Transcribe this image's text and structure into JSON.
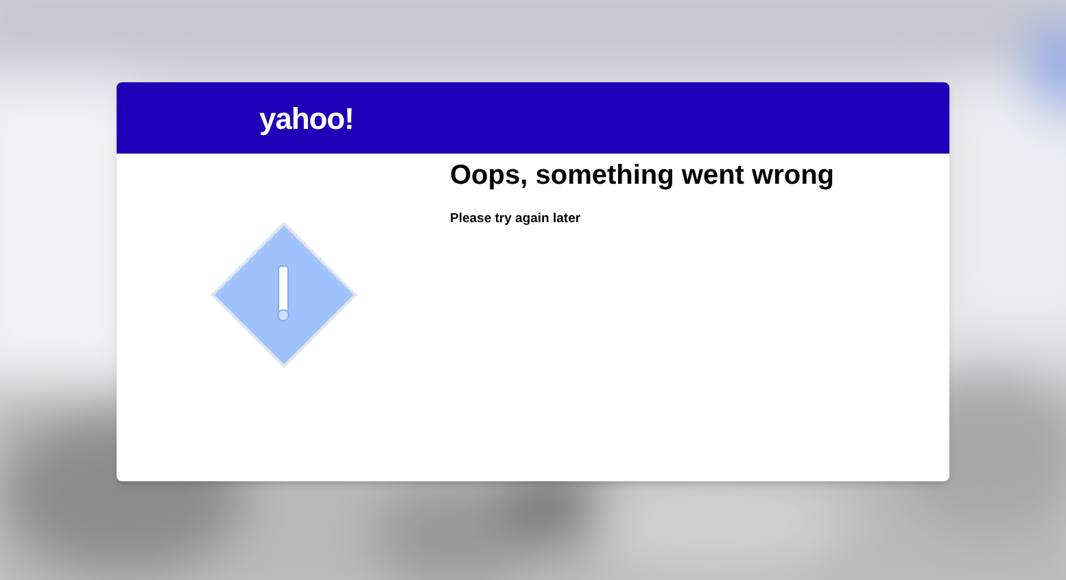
{
  "dialog": {
    "logo": "yahoo!",
    "title": "Oops, something went wrong",
    "message": "Please try again later"
  }
}
